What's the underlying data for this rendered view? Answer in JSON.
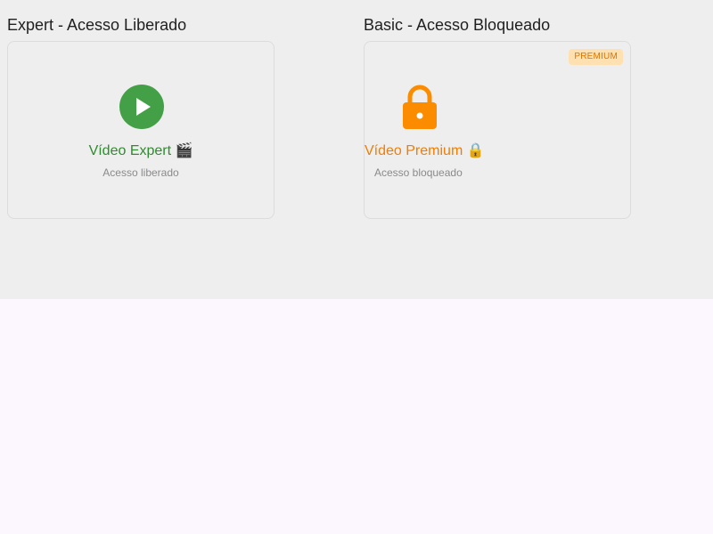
{
  "cards": [
    {
      "section_title": "Expert - Acesso Liberado",
      "video_title": "Vídeo Expert 🎬",
      "status": "Acesso liberado",
      "icon": "play-circle-icon",
      "accent_color": "#43a047"
    },
    {
      "section_title": "Basic - Acesso Bloqueado",
      "video_title": "Vídeo Premium 🔒",
      "status": "Acesso bloqueado",
      "badge": "PREMIUM",
      "icon": "lock-icon",
      "accent_color": "#fb8c00"
    }
  ]
}
